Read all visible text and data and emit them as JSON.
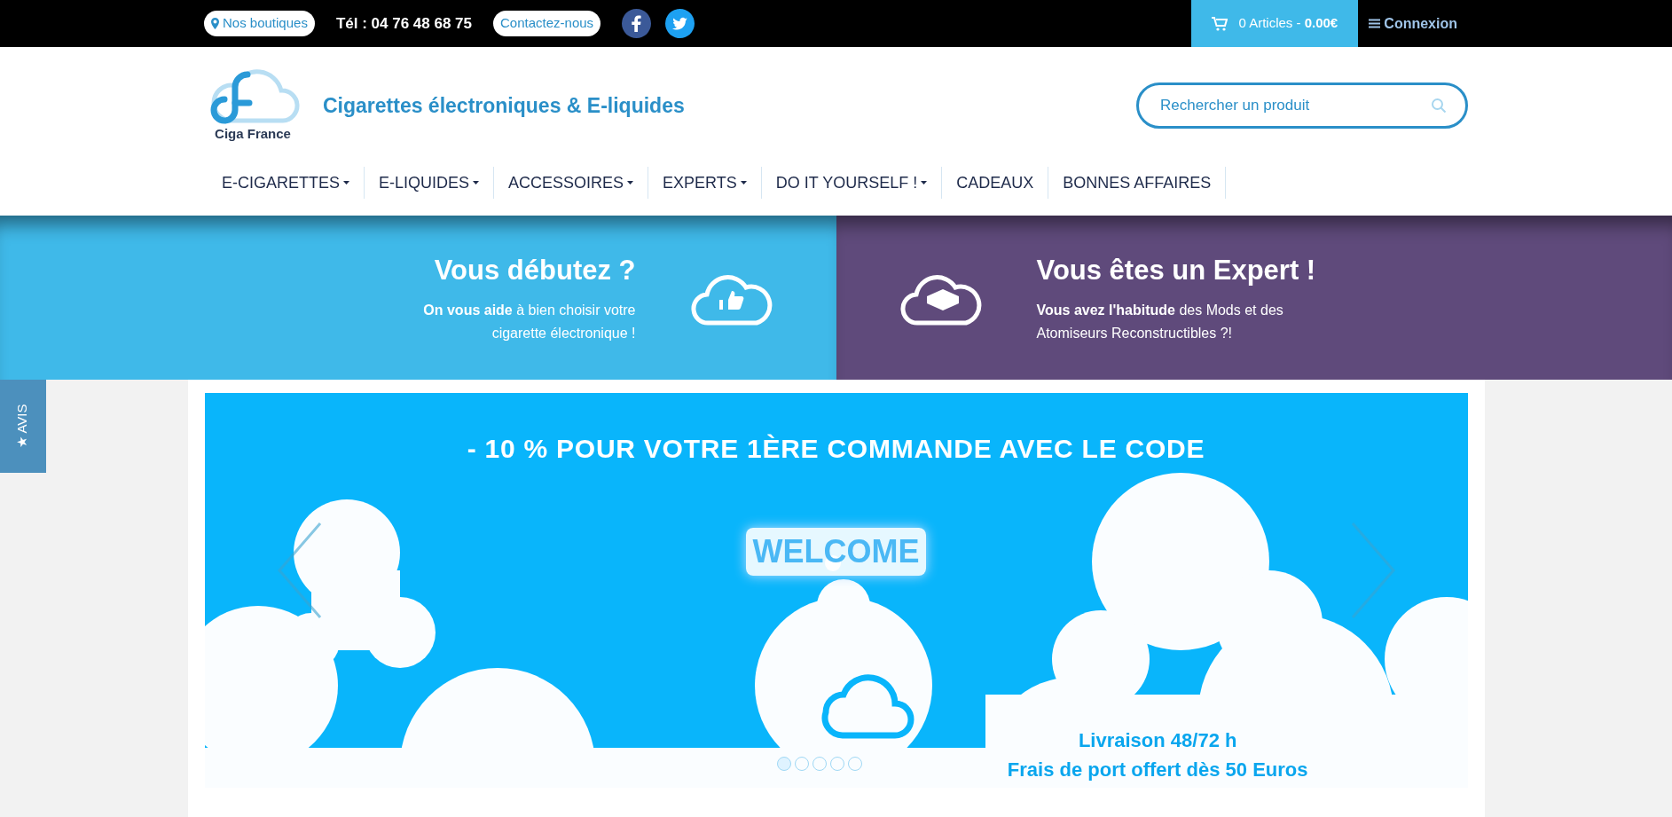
{
  "topbar": {
    "stores_link": "Nos boutiques",
    "phone": "Tél : 04 76 48 68 75",
    "contact_link": "Contactez-nous",
    "cart": "0 Articles - **0.00€**",
    "login": "Connexion"
  },
  "header": {
    "logo_text": "Ciga France",
    "tagline": "Cigarettes électroniques & E-liquides",
    "search": {
      "placeholder": "Rechercher un produit"
    }
  },
  "nav": [
    {
      "label": "E-CIGARETTES",
      "has_dropdown": true
    },
    {
      "label": "E-LIQUIDES",
      "has_dropdown": true
    },
    {
      "label": "ACCESSOIRES",
      "has_dropdown": true
    },
    {
      "label": "EXPERTS",
      "has_dropdown": true
    },
    {
      "label": "DO IT YOURSELF !",
      "has_dropdown": true
    },
    {
      "label": "CADEAUX",
      "has_dropdown": false
    },
    {
      "label": "BONNES AFFAIRES",
      "has_dropdown": false
    }
  ],
  "hero": [
    {
      "title": "Vous débutez ?",
      "text": "**On vous aide** à bien choisir votre cigarette électronique !",
      "color": "#3fb9e9"
    },
    {
      "title": "Vous êtes un Expert !",
      "text": "**Vous avez l'habitude** des Mods et des Atomiseurs Reconstructibles ?!",
      "color": "#5f4a7b"
    }
  ],
  "reviews_tab": "★ AVIS",
  "banner": {
    "headline": "- 10 % POUR VOTRE 1ÈRE COMMANDE AVEC LE CODE",
    "code": "WELCOME",
    "delivery": "Livraison 48/72 h",
    "shipping": "Frais de port offert dès 50 Euros",
    "dots": [
      {
        "selected": true
      },
      {
        "selected": false
      },
      {
        "selected": false
      },
      {
        "selected": false
      },
      {
        "selected": false
      }
    ]
  }
}
